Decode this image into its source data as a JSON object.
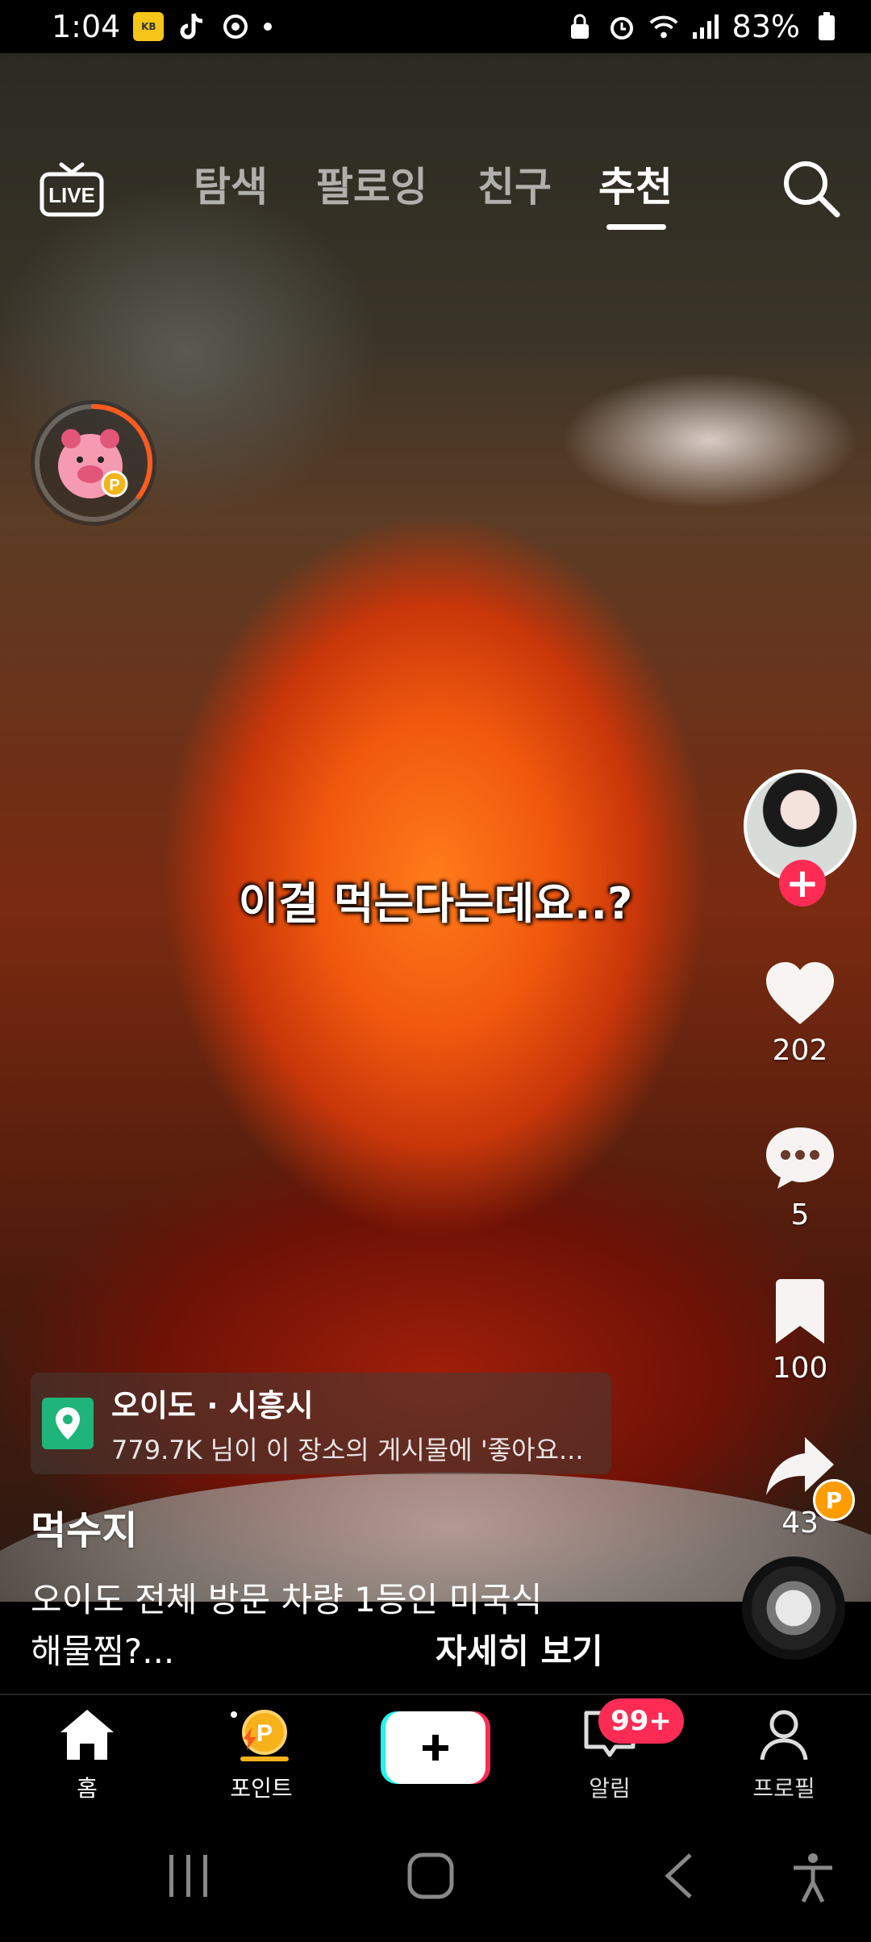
{
  "status_bar": {
    "time": "1:04",
    "kb_label": "KB",
    "battery": "83%"
  },
  "header": {
    "live_label": "LIVE",
    "tabs": [
      {
        "label": "탐색",
        "active": false
      },
      {
        "label": "팔로잉",
        "active": false
      },
      {
        "label": "친구",
        "active": false
      },
      {
        "label": "추천",
        "active": true
      }
    ]
  },
  "video": {
    "caption_overlay": "이걸 먹는다는데요..?"
  },
  "rail": {
    "likes": "202",
    "comments": "5",
    "bookmarks": "100",
    "shares": "43",
    "share_badge": "P"
  },
  "location": {
    "title": "오이도 · 시흥시",
    "subtitle": "779.7K 님이 이 장소의 게시물에 '좋아요..."
  },
  "post": {
    "username": "먹수지",
    "description_line1": "오이도 전체 방문 차량 1등인 미국식",
    "description_line2": "해물찜?...",
    "see_more": "자세히 보기"
  },
  "bottom_nav": {
    "home": "홈",
    "points": "포인트",
    "inbox": "알림",
    "inbox_badge": "99+",
    "profile": "프로필"
  },
  "colors": {
    "accent_red": "#fe2c55",
    "location_green": "#1fb57a",
    "point_orange": "#ff9d00"
  }
}
